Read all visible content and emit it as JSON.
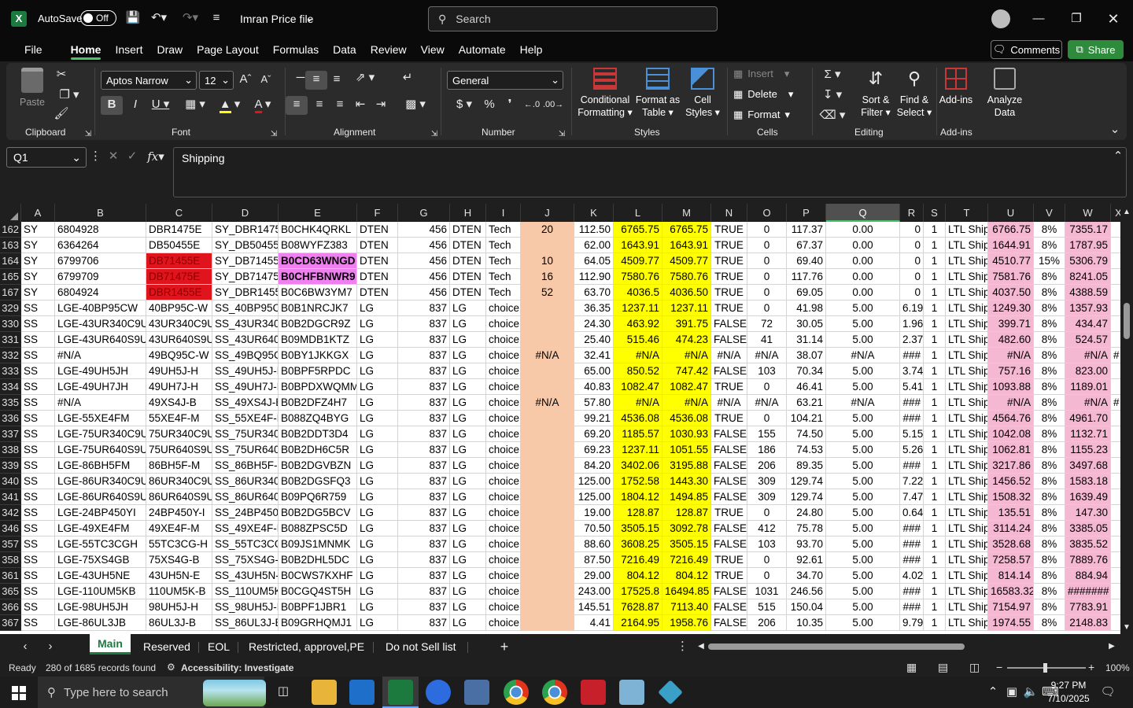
{
  "titlebar": {
    "autosave_label": "AutoSave",
    "autosave_state": "Off",
    "filename": "Imran Price file",
    "search_placeholder": "Search"
  },
  "menu": [
    "File",
    "Home",
    "Insert",
    "Draw",
    "Page Layout",
    "Formulas",
    "Data",
    "Review",
    "View",
    "Automate",
    "Help"
  ],
  "menu_active": "Home",
  "comments_label": "Comments",
  "share_label": "Share",
  "ribbon": {
    "clipboard": {
      "paste": "Paste",
      "label": "Clipboard"
    },
    "font": {
      "name": "Aptos Narrow",
      "size": "12",
      "label": "Font"
    },
    "alignment": {
      "label": "Alignment"
    },
    "number": {
      "format": "General",
      "label": "Number"
    },
    "styles": {
      "cond1": "Conditional",
      "cond2": "Formatting",
      "fmt1": "Format as",
      "fmt2": "Table",
      "cell1": "Cell",
      "cell2": "Styles",
      "label": "Styles"
    },
    "cells": {
      "insert": "Insert",
      "delete": "Delete",
      "format": "Format",
      "label": "Cells"
    },
    "editing": {
      "sort1": "Sort &",
      "sort2": "Filter",
      "find1": "Find &",
      "find2": "Select",
      "label": "Editing"
    },
    "addins": {
      "addins": "Add-ins",
      "analyze1": "Analyze",
      "analyze2": "Data",
      "label": "Add-ins"
    }
  },
  "namebox": "Q1",
  "formula": "Shipping",
  "columns": [
    "A",
    "B",
    "C",
    "D",
    "E",
    "F",
    "G",
    "H",
    "I",
    "J",
    "K",
    "L",
    "M",
    "N",
    "O",
    "P",
    "Q",
    "R",
    "S",
    "T",
    "U",
    "V",
    "W",
    "X"
  ],
  "selected_column": "Q",
  "rows": [
    {
      "n": "162",
      "c": [
        "SY",
        "6804928",
        "DBR1475E",
        "SY_DBR1475E",
        "B0CHK4QRKL",
        "DTEN",
        "456",
        "DTEN",
        "Tech",
        "20",
        "112.50",
        "6765.75",
        "6765.75",
        "TRUE",
        "0",
        "117.37",
        "0.00",
        "0",
        "1",
        "LTL Ship",
        "6766.75",
        "8%",
        "7355.17",
        ""
      ]
    },
    {
      "n": "163",
      "c": [
        "SY",
        "6364264",
        "DB50455E",
        "SY_DB50455E",
        "B08WYFZ383",
        "DTEN",
        "456",
        "DTEN",
        "Tech",
        "",
        "62.00",
        "1643.91",
        "1643.91",
        "TRUE",
        "0",
        "67.37",
        "0.00",
        "0",
        "1",
        "LTL Ship",
        "1644.91",
        "8%",
        "1787.95",
        ""
      ]
    },
    {
      "n": "164",
      "c": [
        "SY",
        "6799706",
        "DB71455E",
        "SY_DB71455E",
        "B0CD63WNGD",
        "DTEN",
        "456",
        "DTEN",
        "Tech",
        "10",
        "64.05",
        "4509.77",
        "4509.77",
        "TRUE",
        "0",
        "69.40",
        "0.00",
        "0",
        "1",
        "LTL Ship",
        "4510.77",
        "15%",
        "5306.79",
        ""
      ]
    },
    {
      "n": "165",
      "c": [
        "SY",
        "6799709",
        "DB71475E",
        "SY_DB71475E",
        "B0CHFBNWR9",
        "DTEN",
        "456",
        "DTEN",
        "Tech",
        "16",
        "112.90",
        "7580.76",
        "7580.76",
        "TRUE",
        "0",
        "117.76",
        "0.00",
        "0",
        "1",
        "LTL Ship",
        "7581.76",
        "8%",
        "8241.05",
        ""
      ]
    },
    {
      "n": "167",
      "c": [
        "SY",
        "6804924",
        "DBR1455E",
        "SY_DBR1455E",
        "B0C6BW3YM7",
        "DTEN",
        "456",
        "DTEN",
        "Tech",
        "52",
        "63.70",
        "4036.5",
        "4036.50",
        "TRUE",
        "0",
        "69.05",
        "0.00",
        "0",
        "1",
        "LTL Ship",
        "4037.50",
        "8%",
        "4388.59",
        ""
      ]
    },
    {
      "n": "329",
      "c": [
        "SS",
        "LGE-40BP95CW",
        "40BP95C-W",
        "SS_40BP95C-W",
        "B0B1NRCJK7",
        "LG",
        "837",
        "LG",
        "choice",
        "",
        "36.35",
        "1237.11",
        "1237.11",
        "TRUE",
        "0",
        "41.98",
        "5.00",
        "6.19",
        "1",
        "LTL Ship",
        "1249.30",
        "8%",
        "1357.93",
        ""
      ]
    },
    {
      "n": "330",
      "c": [
        "SS",
        "LGE-43UR340C9UD",
        "43UR340C9UD",
        "SS_43UR340C9UD",
        "B0B2DGCR9Z",
        "LG",
        "837",
        "LG",
        "choice",
        "",
        "24.30",
        "463.92",
        "391.75",
        "FALSE",
        "72",
        "30.05",
        "5.00",
        "1.96",
        "1",
        "LTL Ship",
        "399.71",
        "8%",
        "434.47",
        ""
      ]
    },
    {
      "n": "331",
      "c": [
        "SS",
        "LGE-43UR640S9UD",
        "43UR640S9UD",
        "SS_43UR640S9UD",
        "B09MDB1KTZ",
        "LG",
        "837",
        "LG",
        "choice",
        "",
        "25.40",
        "515.46",
        "474.23",
        "FALSE",
        "41",
        "31.14",
        "5.00",
        "2.37",
        "1",
        "LTL Ship",
        "482.60",
        "8%",
        "524.57",
        ""
      ]
    },
    {
      "n": "332",
      "c": [
        "SS",
        "#N/A",
        "49BQ95C-W",
        "SS_49BQ95C-W",
        "B0BY1JKKGX",
        "LG",
        "837",
        "LG",
        "choice",
        "#N/A",
        "32.41",
        "#N/A",
        "#N/A",
        "#N/A",
        "#N/A",
        "38.07",
        "#N/A",
        "###",
        "1",
        "LTL Ship",
        "#N/A",
        "8%",
        "#N/A",
        "#"
      ]
    },
    {
      "n": "333",
      "c": [
        "SS",
        "LGE-49UH5JH",
        "49UH5J-H",
        "SS_49UH5J-H",
        "B0BPF5RPDC",
        "LG",
        "837",
        "LG",
        "choice",
        "",
        "65.00",
        "850.52",
        "747.42",
        "FALSE",
        "103",
        "70.34",
        "5.00",
        "3.74",
        "1",
        "LTL Ship",
        "757.16",
        "8%",
        "823.00",
        ""
      ]
    },
    {
      "n": "334",
      "c": [
        "SS",
        "LGE-49UH7JH",
        "49UH7J-H",
        "SS_49UH7J-H",
        "B0BPDXWQMM",
        "LG",
        "837",
        "LG",
        "choice",
        "",
        "40.83",
        "1082.47",
        "1082.47",
        "TRUE",
        "0",
        "46.41",
        "5.00",
        "5.41",
        "1",
        "LTL Ship",
        "1093.88",
        "8%",
        "1189.01",
        ""
      ]
    },
    {
      "n": "335",
      "c": [
        "SS",
        "#N/A",
        "49XS4J-B",
        "SS_49XS4J-B",
        "B0B2DFZ4H7",
        "LG",
        "837",
        "LG",
        "choice",
        "#N/A",
        "57.80",
        "#N/A",
        "#N/A",
        "#N/A",
        "#N/A",
        "63.21",
        "#N/A",
        "###",
        "1",
        "LTL Ship",
        "#N/A",
        "8%",
        "#N/A",
        "#"
      ]
    },
    {
      "n": "336",
      "c": [
        "SS",
        "LGE-55XE4FM",
        "55XE4F-M",
        "SS_55XE4F-M",
        "B088ZQ4BYG",
        "LG",
        "837",
        "LG",
        "choice",
        "",
        "99.21",
        "4536.08",
        "4536.08",
        "TRUE",
        "0",
        "104.21",
        "5.00",
        "###",
        "1",
        "LTL Ship",
        "4564.76",
        "8%",
        "4961.70",
        ""
      ]
    },
    {
      "n": "337",
      "c": [
        "SS",
        "LGE-75UR340C9UD",
        "75UR340C9UD",
        "SS_75UR340C9UD",
        "B0B2DDT3D4",
        "LG",
        "837",
        "LG",
        "choice",
        "",
        "69.20",
        "1185.57",
        "1030.93",
        "FALSE",
        "155",
        "74.50",
        "5.00",
        "5.15",
        "1",
        "LTL Ship",
        "1042.08",
        "8%",
        "1132.71",
        ""
      ]
    },
    {
      "n": "338",
      "c": [
        "SS",
        "LGE-75UR640S9UD",
        "75UR640S9UD",
        "SS_75UR640S9UD",
        "B0B2DH6C5R",
        "LG",
        "837",
        "LG",
        "choice",
        "",
        "69.23",
        "1237.11",
        "1051.55",
        "FALSE",
        "186",
        "74.53",
        "5.00",
        "5.26",
        "1",
        "LTL Ship",
        "1062.81",
        "8%",
        "1155.23",
        ""
      ]
    },
    {
      "n": "339",
      "c": [
        "SS",
        "LGE-86BH5FM",
        "86BH5F-M",
        "SS_86BH5F-M",
        "B0B2DGVBZN",
        "LG",
        "837",
        "LG",
        "choice",
        "",
        "84.20",
        "3402.06",
        "3195.88",
        "FALSE",
        "206",
        "89.35",
        "5.00",
        "###",
        "1",
        "LTL Ship",
        "3217.86",
        "8%",
        "3497.68",
        ""
      ]
    },
    {
      "n": "340",
      "c": [
        "SS",
        "LGE-86UR340C9UD",
        "86UR340C9UD",
        "SS_86UR340C9UD",
        "B0B2DGSFQ3",
        "LG",
        "837",
        "LG",
        "choice",
        "",
        "125.00",
        "1752.58",
        "1443.30",
        "FALSE",
        "309",
        "129.74",
        "5.00",
        "7.22",
        "1",
        "LTL Ship",
        "1456.52",
        "8%",
        "1583.18",
        ""
      ]
    },
    {
      "n": "341",
      "c": [
        "SS",
        "LGE-86UR640S9UD",
        "86UR640S9UD",
        "SS_86UR640S9UD",
        "B09PQ6R759",
        "LG",
        "837",
        "LG",
        "choice",
        "",
        "125.00",
        "1804.12",
        "1494.85",
        "FALSE",
        "309",
        "129.74",
        "5.00",
        "7.47",
        "1",
        "LTL Ship",
        "1508.32",
        "8%",
        "1639.49",
        ""
      ]
    },
    {
      "n": "342",
      "c": [
        "SS",
        "LGE-24BP450YI",
        "24BP450Y-I",
        "SS_24BP450Y-I",
        "B0B2DG5BCV",
        "LG",
        "837",
        "LG",
        "choice",
        "",
        "19.00",
        "128.87",
        "128.87",
        "TRUE",
        "0",
        "24.80",
        "5.00",
        "0.64",
        "1",
        "LTL Ship",
        "135.51",
        "8%",
        "147.30",
        ""
      ]
    },
    {
      "n": "346",
      "c": [
        "SS",
        "LGE-49XE4FM",
        "49XE4F-M",
        "SS_49XE4F-M",
        "B088ZPSC5D",
        "LG",
        "837",
        "LG",
        "choice",
        "",
        "70.50",
        "3505.15",
        "3092.78",
        "FALSE",
        "412",
        "75.78",
        "5.00",
        "###",
        "1",
        "LTL Ship",
        "3114.24",
        "8%",
        "3385.05",
        ""
      ]
    },
    {
      "n": "357",
      "c": [
        "SS",
        "LGE-55TC3CGH",
        "55TC3CG-H",
        "SS_55TC3CG-H",
        "B09JS1MNMK",
        "LG",
        "837",
        "LG",
        "choice",
        "",
        "88.60",
        "3608.25",
        "3505.15",
        "FALSE",
        "103",
        "93.70",
        "5.00",
        "###",
        "1",
        "LTL Ship",
        "3528.68",
        "8%",
        "3835.52",
        ""
      ]
    },
    {
      "n": "358",
      "c": [
        "SS",
        "LGE-75XS4GB",
        "75XS4G-B",
        "SS_75XS4G-B",
        "B0B2DHL5DC",
        "LG",
        "837",
        "LG",
        "choice",
        "",
        "87.50",
        "7216.49",
        "7216.49",
        "TRUE",
        "0",
        "92.61",
        "5.00",
        "###",
        "1",
        "LTL Ship",
        "7258.57",
        "8%",
        "7889.76",
        ""
      ]
    },
    {
      "n": "361",
      "c": [
        "SS",
        "LGE-43UH5NE",
        "43UH5N-E",
        "SS_43UH5N-E",
        "B0CWS7KXHF",
        "LG",
        "837",
        "LG",
        "choice",
        "",
        "29.00",
        "804.12",
        "804.12",
        "TRUE",
        "0",
        "34.70",
        "5.00",
        "4.02",
        "1",
        "LTL Ship",
        "814.14",
        "8%",
        "884.94",
        ""
      ]
    },
    {
      "n": "365",
      "c": [
        "SS",
        "LGE-110UM5KB",
        "110UM5K-B",
        "SS_110UM5K-B",
        "B0CGQ4ST5H",
        "LG",
        "837",
        "LG",
        "choice",
        "",
        "243.00",
        "17525.8",
        "16494.85",
        "FALSE",
        "1031",
        "246.56",
        "5.00",
        "###",
        "1",
        "LTL Ship",
        "16583.32",
        "8%",
        "#######",
        ""
      ]
    },
    {
      "n": "366",
      "c": [
        "SS",
        "LGE-98UH5JH",
        "98UH5J-H",
        "SS_98UH5J-H",
        "B0BPF1JBR1",
        "LG",
        "837",
        "LG",
        "choice",
        "",
        "145.51",
        "7628.87",
        "7113.40",
        "FALSE",
        "515",
        "150.04",
        "5.00",
        "###",
        "1",
        "LTL Ship",
        "7154.97",
        "8%",
        "7783.91",
        ""
      ]
    },
    {
      "n": "367",
      "c": [
        "SS",
        "LGE-86UL3JB",
        "86UL3J-B",
        "SS_86UL3J-B",
        "B09GRHQMJ1",
        "LG",
        "837",
        "LG",
        "choice",
        "",
        "4.41",
        "2164.95",
        "1958.76",
        "FALSE",
        "206",
        "10.35",
        "5.00",
        "9.79",
        "1",
        "LTL Ship",
        "1974.55",
        "8%",
        "2148.83",
        ""
      ]
    }
  ],
  "sheets": [
    "Main",
    "Reserved",
    "EOL",
    "Restricted, approvel,PE",
    "Do not Sell list"
  ],
  "active_sheet": "Main",
  "status": {
    "ready": "Ready",
    "records": "280 of 1685 records found",
    "accessibility": "Accessibility: Investigate",
    "zoom": "100%"
  },
  "taskbar": {
    "search_placeholder": "Type here to search",
    "time": "9:27 PM",
    "date": "7/10/2025"
  },
  "colors": {
    "accent": "#4cc26a",
    "share": "#2e8b3c",
    "highlight_yellow": "#ffff00",
    "highlight_pink": "#f4b8d2"
  }
}
